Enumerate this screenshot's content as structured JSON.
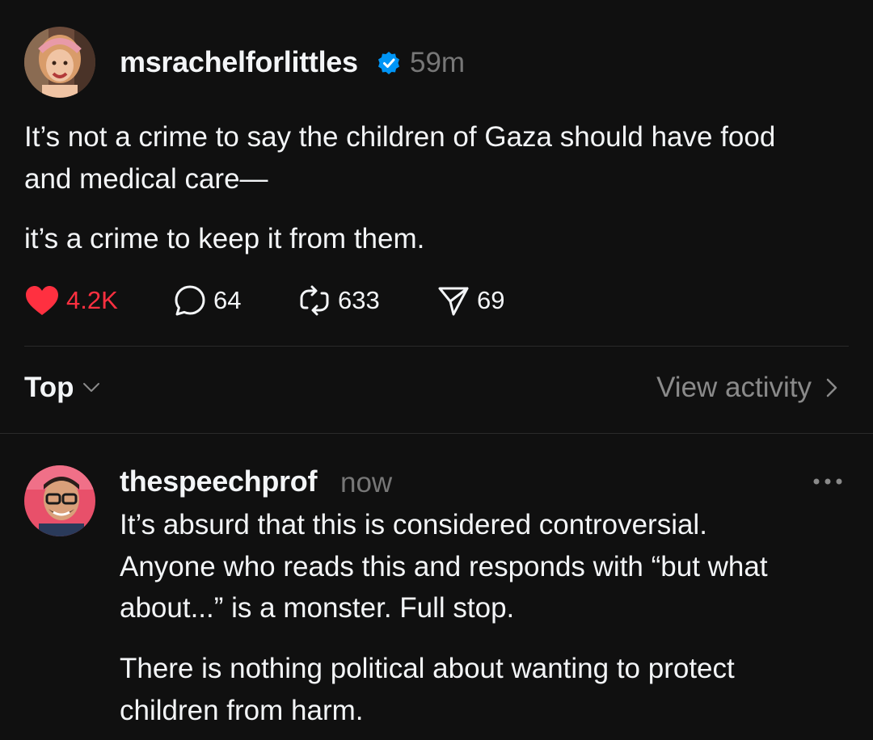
{
  "post": {
    "author": "msrachelforlittles",
    "verified_icon": "verified-badge-icon",
    "time": "59m",
    "paragraphs": {
      "p1_line1": "It’s not a crime to say the children of Gaza should have food",
      "p1_line2": "and medical care—",
      "p2_line1": "it’s a crime to keep it from them."
    },
    "actions": {
      "likes": "4.2K",
      "comments": "64",
      "reposts": "633",
      "shares": "69"
    },
    "colors": {
      "like_red": "#ff3040",
      "verified_blue": "#0095f6"
    }
  },
  "replies_header": {
    "sort_label": "Top",
    "view_activity": "View activity"
  },
  "reply": {
    "author": "thespeechprof",
    "time": "now",
    "lines": {
      "l1": "It’s absurd that this is considered controversial.",
      "l2": "Anyone who reads this and responds with “but what",
      "l3": "about...” is a monster. Full stop.",
      "l4": "There is nothing political about wanting to protect",
      "l5": "children from harm."
    }
  }
}
